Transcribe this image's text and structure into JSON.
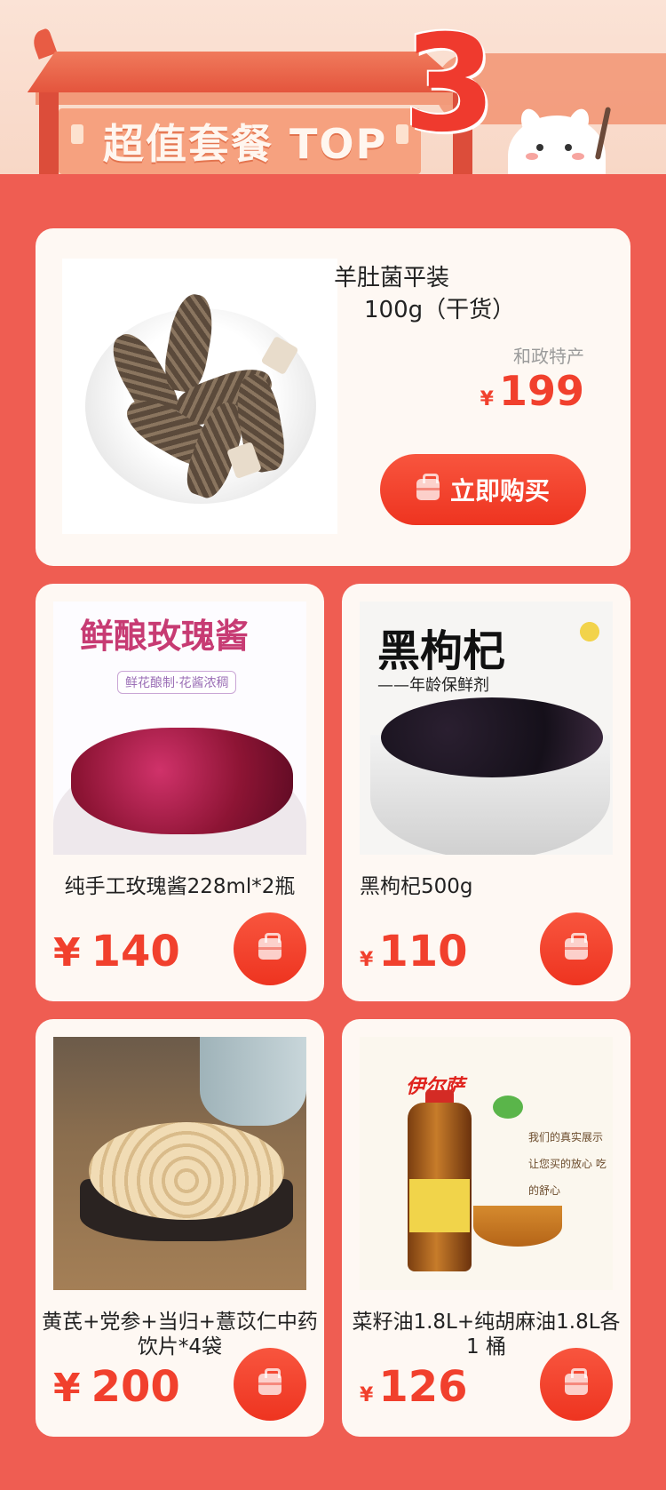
{
  "banner": {
    "title": "超值套餐 TOP",
    "rank_number": "3"
  },
  "featured": {
    "name_line1": "羊肚菌平装",
    "name_line2": "100g（干货）",
    "origin": "和政特产",
    "currency": "¥",
    "price": "199",
    "buy_label": "立即购买"
  },
  "products": [
    {
      "name": "纯手工玫瑰酱228ml*2瓶",
      "currency": "¥",
      "price": "140",
      "image_text": {
        "title": "鲜酿玫瑰酱",
        "subtitle": "鲜花酿制·花酱浓稠"
      }
    },
    {
      "name": "黑枸杞500g",
      "currency": "¥",
      "price": "110",
      "image_text": {
        "title": "黑枸杞",
        "subtitle": "——年龄保鲜剂"
      }
    },
    {
      "name": "黄芪+党参+当归+薏苡仁中药饮片*4袋",
      "currency": "¥",
      "price": "200"
    },
    {
      "name": "菜籽油1.8L+纯胡麻油1.8L各 1 桶",
      "currency": "¥",
      "price": "126",
      "image_text": {
        "brand": "伊尔萨",
        "slogan": "我们的真实展示 让您买的放心 吃的舒心"
      }
    }
  ],
  "colors": {
    "background": "#ef5d52",
    "price": "#f1402d",
    "button": "#ee3420",
    "card": "#fef8f3"
  },
  "icons": {
    "buy": "shopping-bag-icon"
  }
}
